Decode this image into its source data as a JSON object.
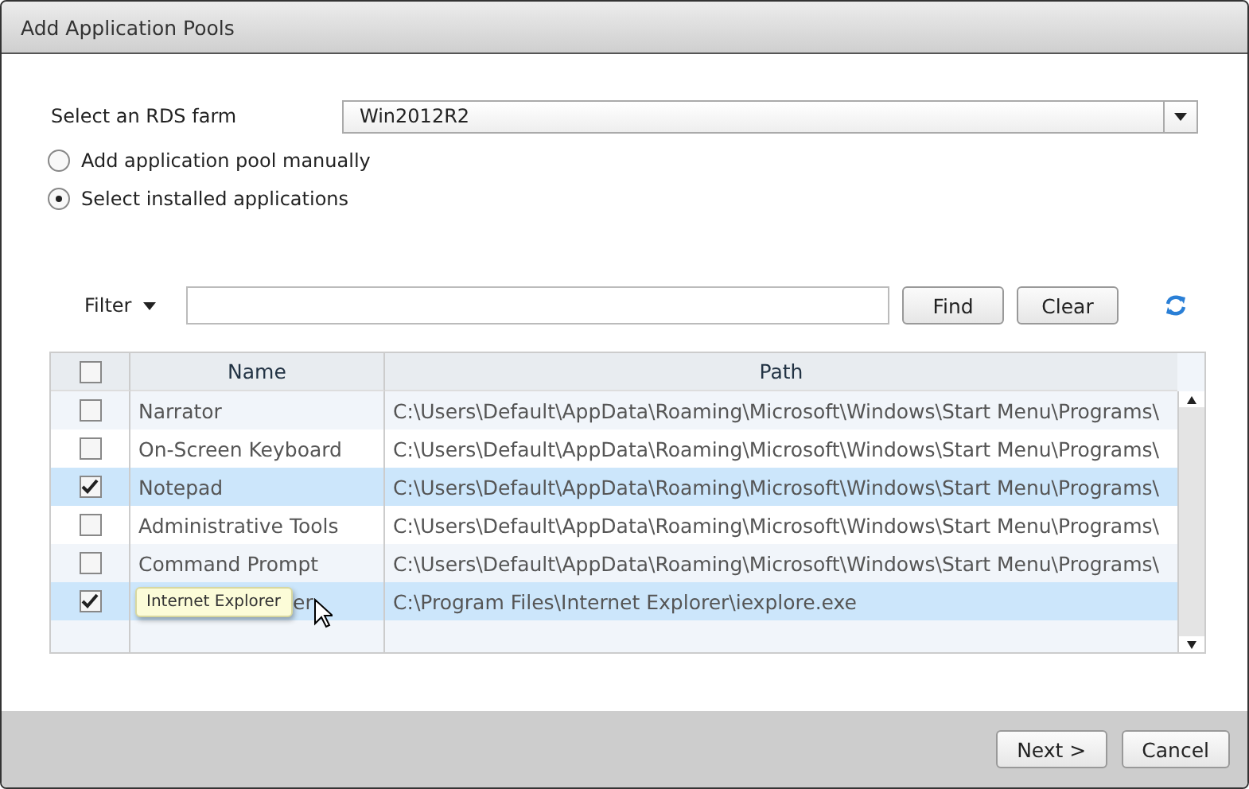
{
  "window": {
    "title": "Add Application Pools"
  },
  "farm": {
    "label": "Select an RDS farm",
    "value": "Win2012R2"
  },
  "mode_options": [
    {
      "label": "Add application pool manually",
      "selected": false
    },
    {
      "label": "Select installed applications",
      "selected": true
    }
  ],
  "filter": {
    "label": "Filter",
    "find": "Find",
    "clear": "Clear"
  },
  "table": {
    "select_all_checked": false,
    "columns": [
      "Name",
      "Path"
    ],
    "rows": [
      {
        "name": "Narrator",
        "path": "C:\\Users\\Default\\AppData\\Roaming\\Microsoft\\Windows\\Start Menu\\Programs\\",
        "checked": false
      },
      {
        "name": "On-Screen Keyboard",
        "path": "C:\\Users\\Default\\AppData\\Roaming\\Microsoft\\Windows\\Start Menu\\Programs\\",
        "checked": false
      },
      {
        "name": "Notepad",
        "path": "C:\\Users\\Default\\AppData\\Roaming\\Microsoft\\Windows\\Start Menu\\Programs\\",
        "checked": true
      },
      {
        "name": "Administrative Tools",
        "path": "C:\\Users\\Default\\AppData\\Roaming\\Microsoft\\Windows\\Start Menu\\Programs\\",
        "checked": false
      },
      {
        "name": "Command Prompt",
        "path": "C:\\Users\\Default\\AppData\\Roaming\\Microsoft\\Windows\\Start Menu\\Programs\\",
        "checked": false
      },
      {
        "name": "er",
        "path": "C:\\Program Files\\Internet Explorer\\iexplore.exe",
        "checked": true,
        "tooltip": "Internet Explorer"
      }
    ]
  },
  "buttons": [
    "Next >",
    "Cancel"
  ]
}
